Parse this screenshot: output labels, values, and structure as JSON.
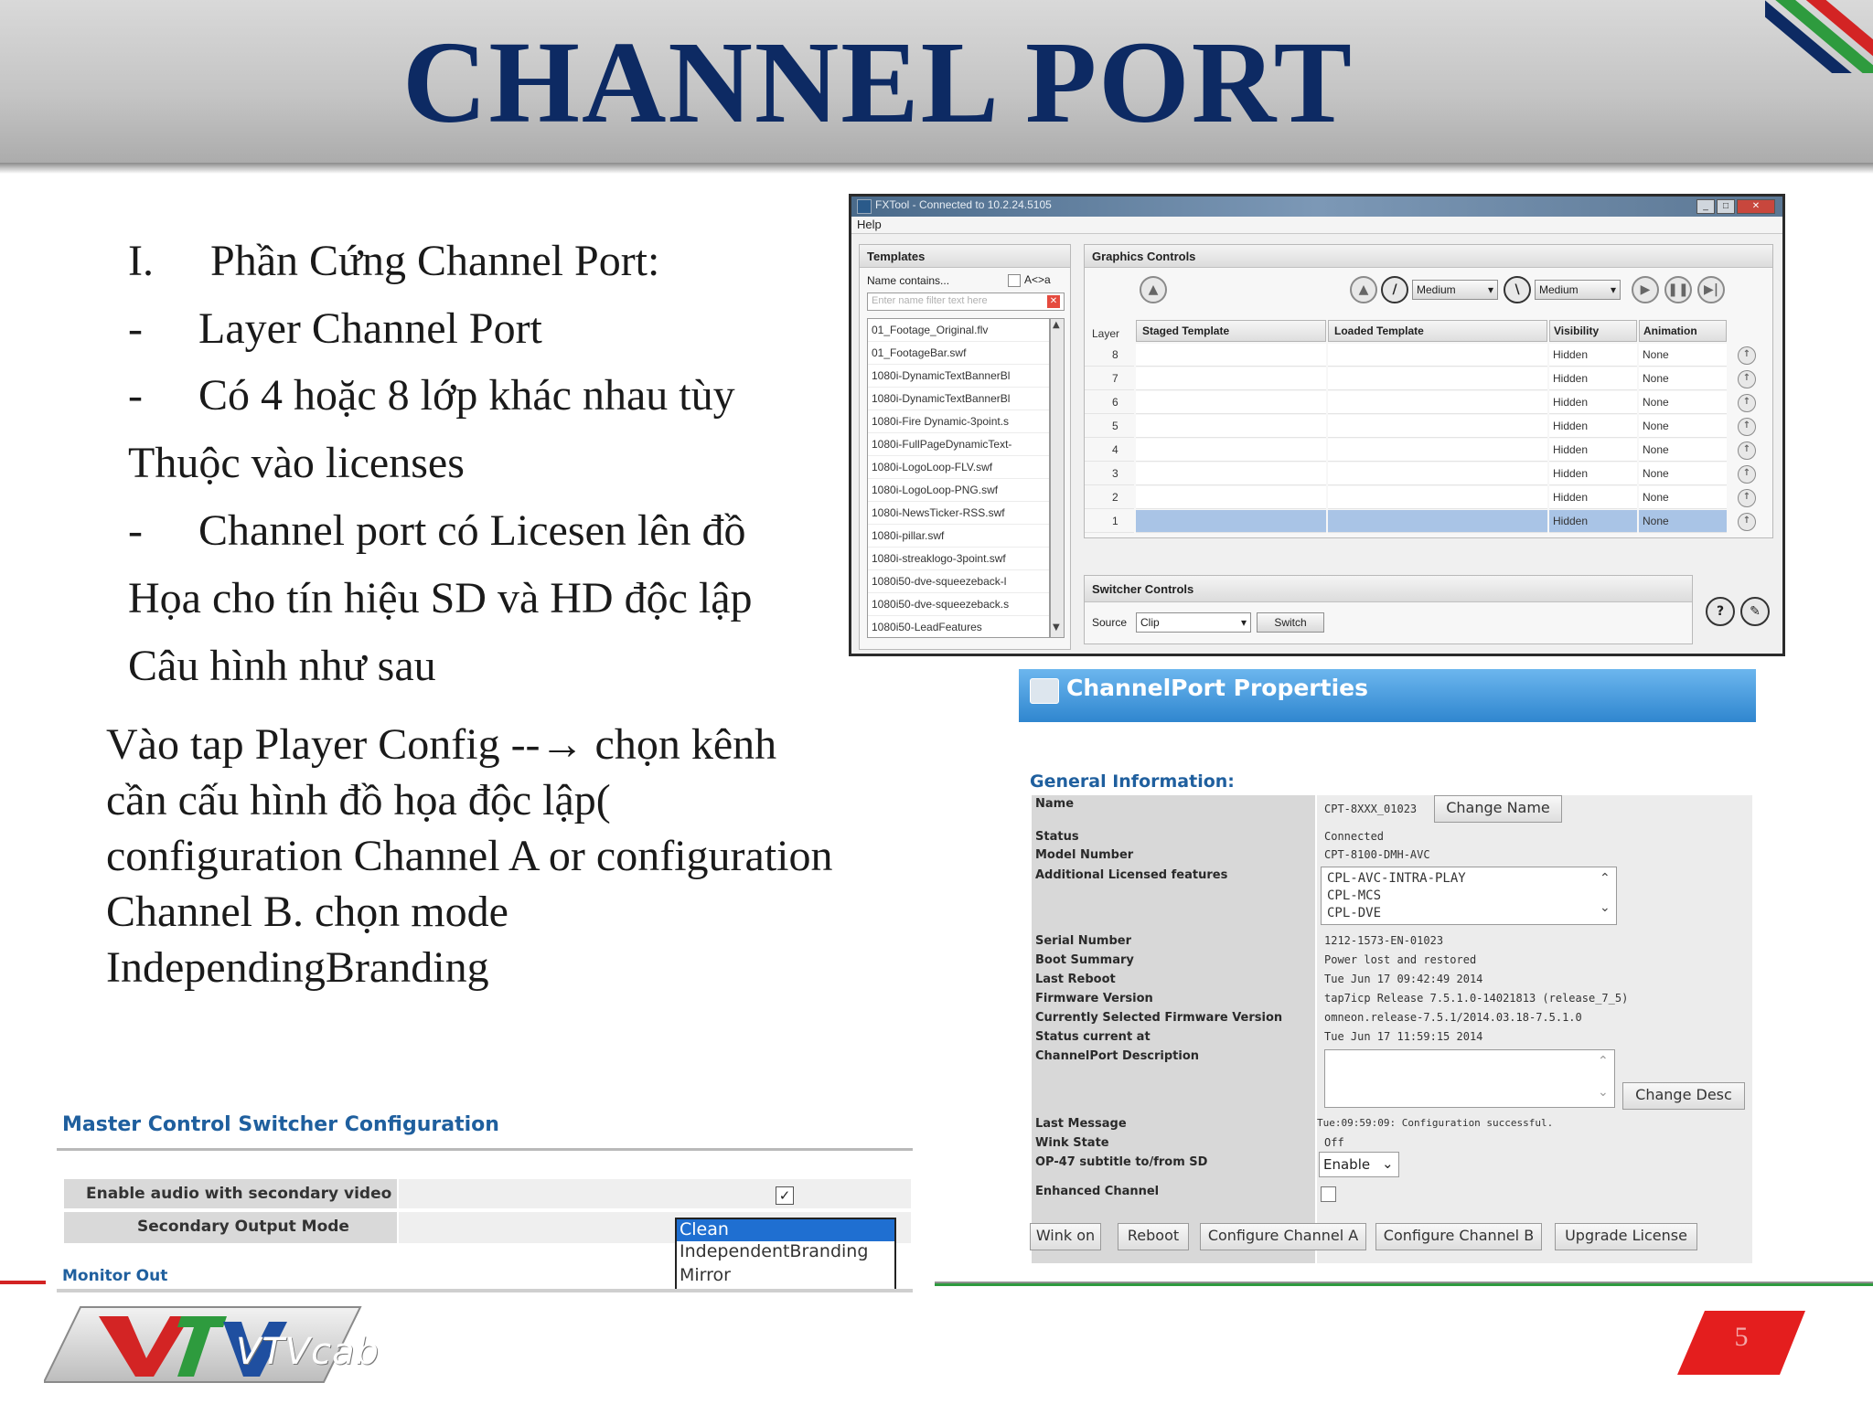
{
  "slide": {
    "title": "CHANNEL PORT",
    "page_number": "5",
    "accent_colors": {
      "title": "#0d2a63",
      "red": "#d32424",
      "green": "#2e9b3e",
      "blue": "#2f86cf"
    }
  },
  "body": {
    "heading_number": "I.",
    "heading_text": "Phần Cứng Channel Port:",
    "bullet_dash": "-",
    "bullet_1": "Layer Channel Port",
    "bullet_2": "Có 4 hoặc 8 lớp khác nhau tùy",
    "line_2b": "Thuộc vào licenses",
    "bullet_3": "Channel port có Licesen lên đồ",
    "line_3b": "Họa cho tín hiệu SD và HD độc lập",
    "line_3c": "Câu hình như sau",
    "paragraph": "Vào tap Player Config --→ chọn kênh cần cấu hình đồ họa độc lập( configuration Channel A or configuration Channel B. chọn mode IndependingBranding"
  },
  "fxtool": {
    "window_title": "FXTool - Connected to 10.2.24.5105",
    "menu_help": "Help",
    "templates": {
      "header": "Templates",
      "filter_label": "Name contains...",
      "case_label": "A<>a",
      "filter_placeholder": "Enter name filter text here",
      "files": [
        "01_Footage_Original.flv",
        "01_FootageBar.swf",
        "1080i-DynamicTextBannerBl",
        "1080i-DynamicTextBannerBl",
        "1080i-Fire Dynamic-3point.s",
        "1080i-FullPageDynamicText-",
        "1080i-LogoLoop-FLV.swf",
        "1080i-LogoLoop-PNG.swf",
        "1080i-NewsTicker-RSS.swf",
        "1080i-pillar.swf",
        "1080i-streaklogo-3point.swf",
        "1080i50-dve-squeezeback-l",
        "1080i50-dve-squeezeback.s",
        "1080i50-LeadFeatures"
      ]
    },
    "graphics": {
      "header": "Graphics Controls",
      "speed_1": "Medium",
      "speed_2": "Medium",
      "col_layer": "Layer",
      "col_staged": "Staged Template",
      "col_loaded": "Loaded Template",
      "col_visibility": "Visibility",
      "col_animation": "Animation",
      "layers": [
        {
          "n": "8",
          "vis": "Hidden",
          "anim": "None"
        },
        {
          "n": "7",
          "vis": "Hidden",
          "anim": "None"
        },
        {
          "n": "6",
          "vis": "Hidden",
          "anim": "None"
        },
        {
          "n": "5",
          "vis": "Hidden",
          "anim": "None"
        },
        {
          "n": "4",
          "vis": "Hidden",
          "anim": "None"
        },
        {
          "n": "3",
          "vis": "Hidden",
          "anim": "None"
        },
        {
          "n": "2",
          "vis": "Hidden",
          "anim": "None"
        },
        {
          "n": "1",
          "vis": "Hidden",
          "anim": "None"
        }
      ]
    },
    "switcher": {
      "header": "Switcher Controls",
      "source_label": "Source",
      "source_value": "Clip",
      "switch_button": "Switch"
    }
  },
  "channelport": {
    "title": "ChannelPort Properties",
    "section": "General Information:",
    "rows": {
      "name_label": "Name",
      "name_value": "CPT-8XXX_01023",
      "change_name": "Change Name",
      "status_label": "Status",
      "status_value": "Connected",
      "model_label": "Model Number",
      "model_value": "CPT-8100-DMH-AVC",
      "features_label": "Additional Licensed features",
      "features": [
        "CPL-AVC-INTRA-PLAY",
        "CPL-MCS",
        "CPL-DVE"
      ],
      "serial_label": "Serial Number",
      "serial_value": "1212-1573-EN-01023",
      "boot_label": "Boot Summary",
      "boot_value": "Power lost and restored",
      "reboot_label": "Last Reboot",
      "reboot_value": "Tue Jun 17 09:42:49 2014",
      "fw_label": "Firmware Version",
      "fw_value": "tap7icp Release 7.5.1.0-14021813 (release_7_5)",
      "fw_sel_label": "Currently Selected Firmware Version",
      "fw_sel_value": "omneon.release-7.5.1/2014.03.18-7.5.1.0",
      "status_at_label": "Status current at",
      "status_at_value": "Tue Jun 17 11:59:15 2014",
      "desc_label": "ChannelPort Description",
      "change_desc": "Change Desc",
      "msg_label": "Last Message",
      "msg_value": "Tue:09:59:09: Configuration successful.",
      "wink_label": "Wink State",
      "wink_value": "Off",
      "op47_label": "OP-47 subtitle to/from SD",
      "op47_value": "Enable",
      "enhanced_label": "Enhanced Channel"
    },
    "buttons": [
      "Wink on",
      "Reboot",
      "Configure Channel A",
      "Configure Channel B",
      "Upgrade License"
    ]
  },
  "master_control": {
    "title": "Master Control Switcher Configuration",
    "row1_label": "Enable audio with secondary video",
    "row2_label": "Secondary Output Mode",
    "options": [
      "Clean",
      "IndependentBranding",
      "Mirror"
    ],
    "monitor_out": "Monitor Out"
  },
  "logo": {
    "text": "VTVcab"
  }
}
